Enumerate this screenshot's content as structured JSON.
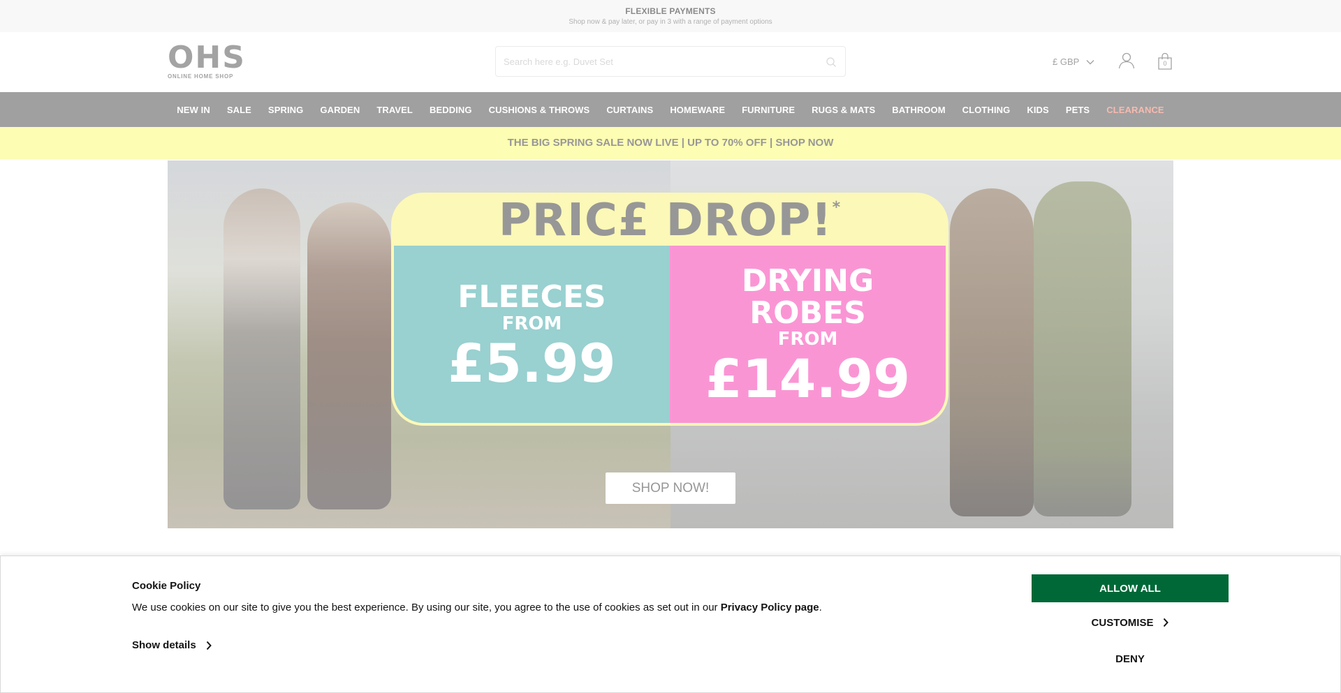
{
  "promo": {
    "title": "FLEXIBLE PAYMENTS",
    "subtitle": "Shop now & pay later, or pay in 3 with a range of payment options"
  },
  "header": {
    "logo_mark": "OHS",
    "logo_tag": "ONLINE HOME SHOP",
    "search_placeholder": "Search here e.g. Duvet Set",
    "currency": "£ GBP",
    "bag_count": "0"
  },
  "nav": {
    "items": [
      "NEW IN",
      "SALE",
      "SPRING",
      "GARDEN",
      "TRAVEL",
      "BEDDING",
      "CUSHIONS & THROWS",
      "CURTAINS",
      "HOMEWARE",
      "FURNITURE",
      "RUGS & MATS",
      "BATHROOM",
      "CLOTHING",
      "KIDS",
      "PETS",
      "CLEARANCE"
    ]
  },
  "sale_banner": "THE BIG SPRING SALE NOW LIVE | UP TO 70% OFF | SHOP NOW",
  "hero": {
    "headline": "PRIC£ DROP!",
    "asterisk": "*",
    "left_line1": "FLEECES",
    "left_line2": "FROM",
    "left_price": "£5.99",
    "right_line1": "DRYING",
    "right_line2": "ROBES",
    "right_line3": "FROM",
    "right_price": "£14.99",
    "cta": "SHOP NOW!"
  },
  "cookie": {
    "title": "Cookie Policy",
    "text_before": "We use cookies on our site to give you the best experience. By using our site, you agree to the use of cookies as set out in our ",
    "link": "Privacy Policy page",
    "text_after": ".",
    "show_details": "Show details",
    "allow_all": "ALLOW ALL",
    "customise": "CUSTOMISE",
    "deny": "DENY"
  }
}
